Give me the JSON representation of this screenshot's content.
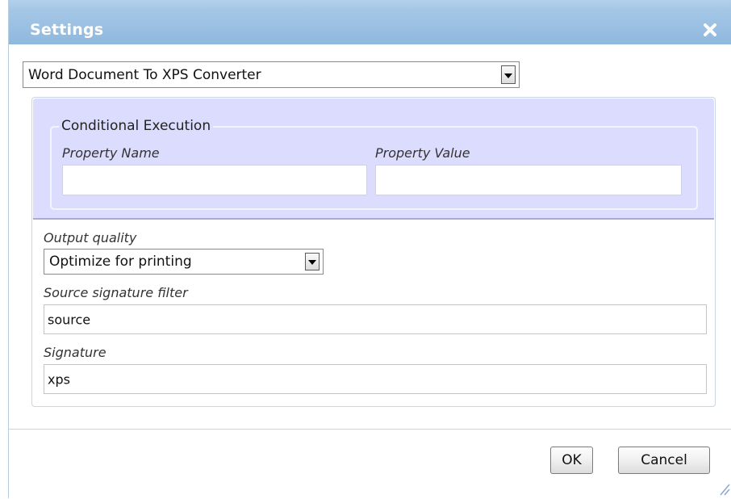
{
  "dialog": {
    "title": "Settings",
    "close_icon": "close-icon"
  },
  "converter_select": {
    "selected": "Word Document To XPS Converter"
  },
  "conditional_execution": {
    "legend": "Conditional Execution",
    "property_name_label": "Property Name",
    "property_name_value": "",
    "property_value_label": "Property Value",
    "property_value_value": ""
  },
  "output_quality": {
    "label": "Output quality",
    "selected": "Optimize for printing"
  },
  "source_signature_filter": {
    "label": "Source signature filter",
    "value": "source"
  },
  "signature": {
    "label": "Signature",
    "value": "xps"
  },
  "buttons": {
    "ok_label": "OK",
    "cancel_label": "Cancel"
  },
  "icons": [
    "close-icon",
    "chevron-down-icon",
    "resize-grip-icon"
  ],
  "colors": {
    "titlebar": "#a5c7e6",
    "conditional_panel": "#dcdcff",
    "title_text": "#ffffff"
  }
}
